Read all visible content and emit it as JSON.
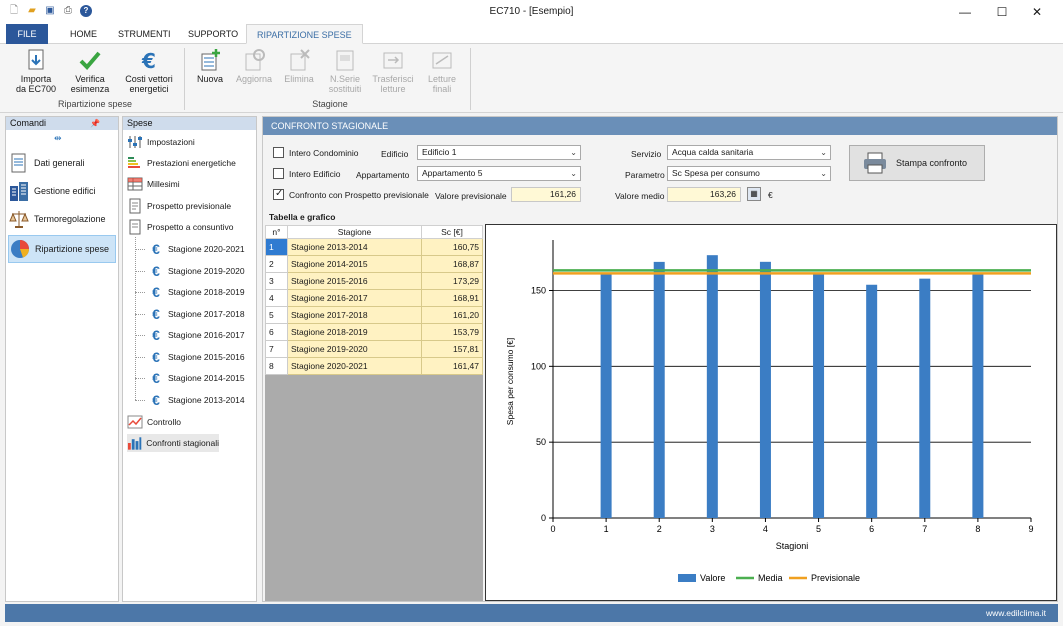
{
  "window": {
    "title": "EC710 - [Esempio]"
  },
  "tabs": [
    "FILE",
    "HOME",
    "STRUMENTI",
    "SUPPORTO",
    "RIPARTIZIONE SPESE"
  ],
  "ribbon": {
    "group1": {
      "label": "Ripartizione spese",
      "buttons": [
        {
          "label1": "Importa",
          "label2": "da EC700"
        },
        {
          "label1": "Verifica",
          "label2": "esimenza"
        },
        {
          "label1": "Costi vettori",
          "label2": "energetici"
        }
      ]
    },
    "group2": {
      "label": "Stagione",
      "buttons": [
        {
          "label1": "Nuova",
          "label2": ""
        },
        {
          "label1": "Aggiorna",
          "label2": ""
        },
        {
          "label1": "Elimina",
          "label2": ""
        },
        {
          "label1": "N.Serie",
          "label2": "sostituiti"
        },
        {
          "label1": "Trasferisci",
          "label2": "letture"
        },
        {
          "label1": "Letture",
          "label2": "finali"
        }
      ]
    }
  },
  "comandi": {
    "header": "Comandi",
    "items": [
      "Dati generali",
      "Gestione edifici",
      "Termoregolazione",
      "Ripartizione spese"
    ]
  },
  "spese": {
    "header": "Spese",
    "items": [
      "Impostazioni",
      "Prestazioni energetiche",
      "Millesimi",
      "Prospetto previsionale",
      "Prospetto a consuntivo"
    ],
    "seasons": [
      "Stagione 2020-2021",
      "Stagione 2019-2020",
      "Stagione 2018-2019",
      "Stagione 2017-2018",
      "Stagione 2016-2017",
      "Stagione 2015-2016",
      "Stagione 2014-2015",
      "Stagione 2013-2014"
    ],
    "tail": [
      "Controllo",
      "Confronti stagionali"
    ]
  },
  "main": {
    "header": "CONFRONTO STAGIONALE",
    "intero_condominio": "Intero Condominio",
    "intero_edificio": "Intero Edificio",
    "confronto_prospetto": "Confronto con Prospetto previsionale",
    "edificio_label": "Edificio",
    "edificio_value": "Edificio 1",
    "appartamento_label": "Appartamento",
    "appartamento_value": "Appartamento 5",
    "servizio_label": "Servizio",
    "servizio_value": "Acqua calda sanitaria",
    "parametro_label": "Parametro",
    "parametro_value": "Sc Spesa per consumo",
    "valore_previsionale_label": "Valore previsionale",
    "valore_previsionale": "161,26",
    "valore_medio_label": "Valore medio",
    "valore_medio": "163,26",
    "currency": "€",
    "stampa": "Stampa confronto",
    "tabella_label": "Tabella e grafico"
  },
  "table": {
    "headers": [
      "n°",
      "Stagione",
      "Sc [€]"
    ],
    "rows": [
      [
        "1",
        "Stagione 2013-2014",
        "160,75"
      ],
      [
        "2",
        "Stagione 2014-2015",
        "168,87"
      ],
      [
        "3",
        "Stagione 2015-2016",
        "173,29"
      ],
      [
        "4",
        "Stagione 2016-2017",
        "168,91"
      ],
      [
        "5",
        "Stagione 2017-2018",
        "161,20"
      ],
      [
        "6",
        "Stagione 2018-2019",
        "153,79"
      ],
      [
        "7",
        "Stagione 2019-2020",
        "157,81"
      ],
      [
        "8",
        "Stagione 2020-2021",
        "161,47"
      ]
    ]
  },
  "chart_data": {
    "type": "bar",
    "x": [
      1,
      2,
      3,
      4,
      5,
      6,
      7,
      8
    ],
    "series": [
      {
        "name": "Valore",
        "values": [
          160.75,
          168.87,
          173.29,
          168.91,
          161.2,
          153.79,
          157.81,
          161.47
        ],
        "color": "#3b7dc4"
      },
      {
        "name": "Media",
        "values": [
          163.26
        ],
        "color": "#4caf50"
      },
      {
        "name": "Previsionale",
        "values": [
          161.26
        ],
        "color": "#f0a020"
      }
    ],
    "xlabel": "Stagioni",
    "ylabel": "Spesa per consumo [€]",
    "xlim": [
      0,
      9
    ],
    "ylim": [
      0,
      180
    ],
    "xticks": [
      0,
      1,
      2,
      3,
      4,
      5,
      6,
      7,
      8,
      9
    ],
    "yticks": [
      0,
      50,
      100,
      150
    ],
    "grid": true,
    "legend": "bottom"
  },
  "status": {
    "text": "www.edilclima.it"
  }
}
